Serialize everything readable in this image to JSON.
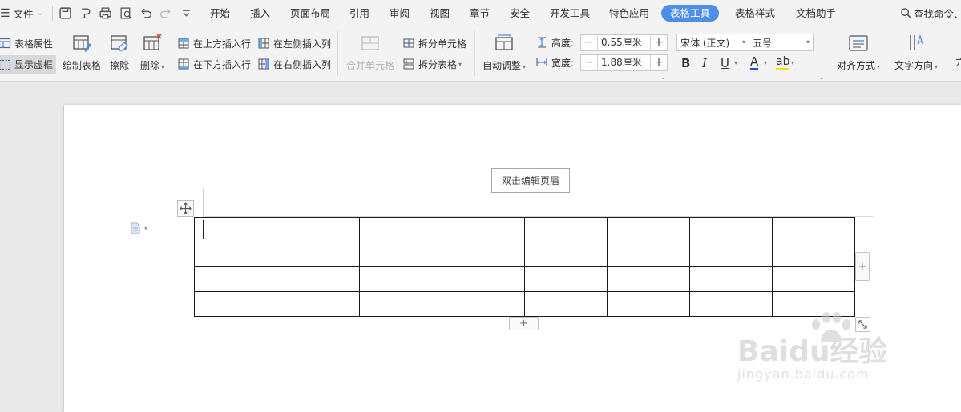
{
  "menubar": {
    "menu_icon": "hamburger-icon",
    "file_label": "文件",
    "tabs": [
      {
        "label": "开始"
      },
      {
        "label": "插入"
      },
      {
        "label": "页面布局"
      },
      {
        "label": "引用"
      },
      {
        "label": "审阅"
      },
      {
        "label": "视图"
      },
      {
        "label": "章节"
      },
      {
        "label": "安全"
      },
      {
        "label": "开发工具"
      },
      {
        "label": "特色应用"
      },
      {
        "label": "表格工具",
        "active": true
      },
      {
        "label": "表格样式"
      },
      {
        "label": "文档助手"
      }
    ],
    "search_label": "查找命令、"
  },
  "ribbon": {
    "table_props": "表格属性",
    "show_gridlines": "显示虚框",
    "draw_table": "绘制表格",
    "eraser": "擦除",
    "delete": "删除",
    "insert_row_above": "在上方插入行",
    "insert_row_below": "在下方插入行",
    "insert_col_left": "在左侧插入列",
    "insert_col_right": "在右侧插入列",
    "merge_cells": "合并单元格",
    "split_cells": "拆分单元格",
    "split_table": "拆分表格",
    "auto_fit": "自动调整",
    "height_label": "高度:",
    "height_value": "0.55厘米",
    "width_label": "宽度:",
    "width_value": "1.88厘米",
    "font_name": "宋体 (正文)",
    "font_size": "五号",
    "bold": "B",
    "italic": "I",
    "underline": "U",
    "font_color": "A",
    "highlight": "ab",
    "align": "对齐方式",
    "text_direction": "文字方向"
  },
  "document": {
    "header_tip": "双击编辑页眉",
    "table": {
      "rows": 4,
      "cols": 8
    }
  },
  "watermark": {
    "brand": "Baidu经验",
    "url": "jingyan.baidu.com"
  },
  "colors": {
    "accent": "#4d8fe8",
    "ribbon_bg": "#f3f3f3",
    "canvas_bg": "#e9e9e9"
  }
}
